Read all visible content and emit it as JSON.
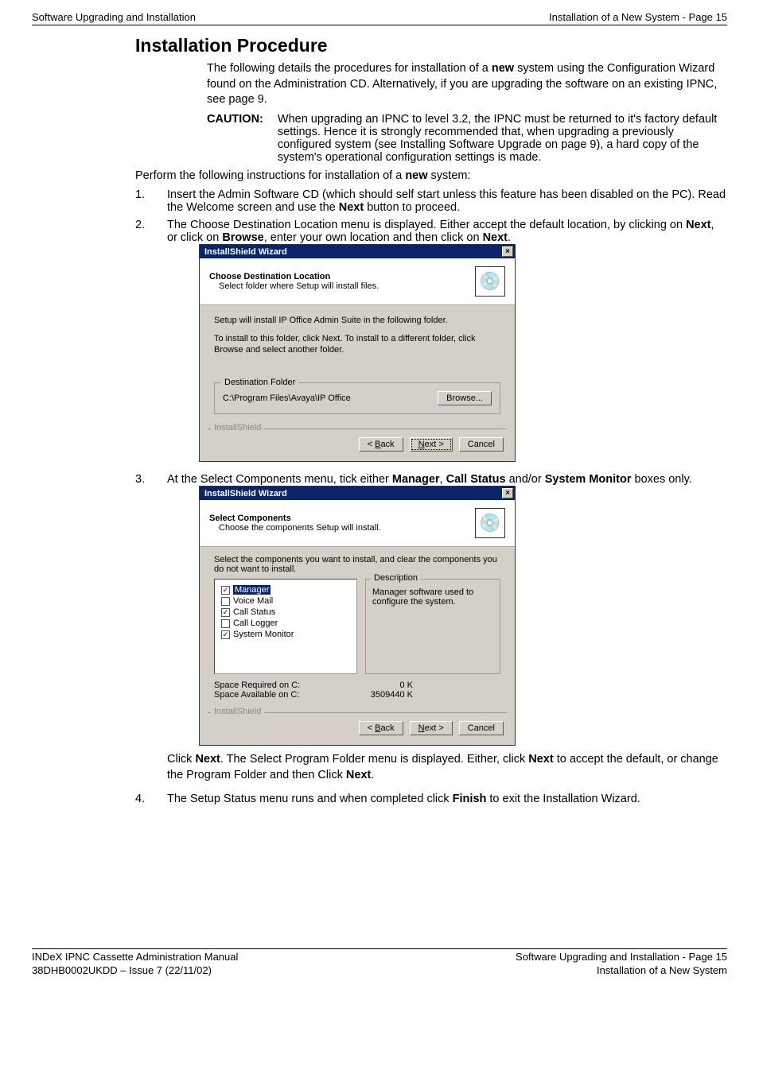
{
  "topbar": {
    "left": "Software Upgrading and Installation",
    "right": "Installation of a New System - Page 15"
  },
  "title": "Installation Procedure",
  "para1_a": "The following details the procedures for installation of a ",
  "para1_bold": "new",
  "para1_b": " system using the Configuration Wizard found on the Administration CD. Alternatively, if you are upgrading the software on an existing IPNC, see page 9.",
  "caution_label": "CAUTION:",
  "caution_text": "When upgrading an IPNC to level 3.2, the IPNC must be returned to it's factory default settings. Hence it is strongly recommended that, when upgrading a previously configured system (see Installing Software Upgrade on page 9), a hard copy of the system's operational configuration settings is made.",
  "para2_a": "Perform the following instructions for installation of a ",
  "para2_bold": "new",
  "para2_b": " system:",
  "step1_a": "Insert the Admin Software CD (which should self start unless this feature has been disabled on the PC). Read the Welcome screen and use the ",
  "step1_bold": "Next",
  "step1_b": " button to proceed.",
  "step2_a": "The Choose Destination Location menu is displayed. Either accept the default location, by clicking on ",
  "step2_b1": "Next",
  "step2_c": ", or click on ",
  "step2_b2": "Browse",
  "step2_d": ", enter your own location and then click on ",
  "step2_b3": "Next",
  "step2_e": ".",
  "step3_a": "At the Select Components menu, tick either ",
  "step3_b1": "Manager",
  "step3_c": ", ",
  "step3_b2": "Call Status",
  "step3_d": " and/or ",
  "step3_b3": "System Monitor",
  "step3_e": " boxes only.",
  "after3_a": "Click ",
  "after3_b1": "Next",
  "after3_c": ". The Select Program Folder menu is displayed. Either, click ",
  "after3_b2": "Next",
  "after3_d": " to accept the default, or change the Program Folder and then Click ",
  "after3_b3": "Next",
  "after3_e": ".",
  "step4_a": "The Setup Status menu runs and when completed click ",
  "step4_b": "Finish",
  "step4_c": " to exit the Installation Wizard.",
  "dlg1": {
    "title": "InstallShield Wizard",
    "h_title": "Choose Destination Location",
    "h_sub": "Select folder where Setup will install files.",
    "line1": "Setup will install IP Office Admin Suite in the following folder.",
    "line2": "To install to this folder, click Next. To install to a different folder, click Browse and select another folder.",
    "dest_legend": "Destination Folder",
    "dest_path": "C:\\Program Files\\Avaya\\IP Office",
    "browse": "Browse...",
    "sep": "InstallShield",
    "back": "< Back",
    "next": "Next >",
    "cancel": "Cancel"
  },
  "dlg2": {
    "title": "InstallShield Wizard",
    "h_title": "Select Components",
    "h_sub": "Choose the components Setup will install.",
    "prompt": "Select the components you want to install, and clear the components you do not want to install.",
    "items": [
      "Manager",
      "Voice Mail",
      "Call Status",
      "Call Logger",
      "System Monitor"
    ],
    "desc_legend": "Description",
    "desc_text": "Manager software used to configure the system.",
    "space_req_label": "Space Required on  C:",
    "space_req_val": "0 K",
    "space_avail_label": "Space Available on  C:",
    "space_avail_val": "3509440 K",
    "sep": "InstallShield",
    "back": "< Back",
    "next": "Next >",
    "cancel": "Cancel"
  },
  "footer": {
    "left1": "INDeX IPNC Cassette Administration Manual",
    "left2": "38DHB0002UKDD – Issue 7 (22/11/02)",
    "right1": "Software Upgrading and Installation - Page 15",
    "right2": "Installation of a New System"
  }
}
